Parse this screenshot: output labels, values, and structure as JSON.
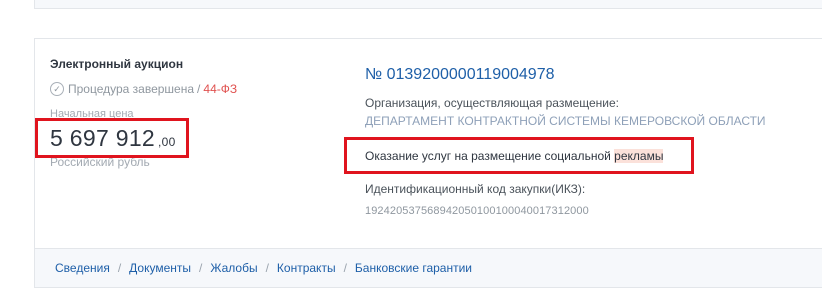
{
  "nav_tabs": [
    "Сведения",
    "Документы",
    "Жалобы",
    "Контракты",
    "Банковские гарантии"
  ],
  "auction": {
    "type": "Электронный аукцион",
    "status": "Процедура завершена",
    "law": "44-ФЗ",
    "price_label": "Начальная цена",
    "price_main": "5 697 912",
    "price_cents": ",00",
    "currency": "Российский рубль",
    "number": "№ 0139200000119004978",
    "org_label": "Организация, осуществляющая размещение:",
    "org_name": "ДЕПАРТАМЕНТ КОНТРАКТНОЙ СИСТЕМЫ КЕМЕРОВСКОЙ ОБЛАСТИ",
    "subject_plain": "Оказание услуг на размещение социальной ",
    "subject_highlight": "рекламы",
    "ikz_label": "Идентификационный код закупки(ИКЗ):",
    "ikz_value": "192420537568942050100100040017312000"
  },
  "colors": {
    "link": "#1e5fa8",
    "law": "#e0514f",
    "highlight_box": "#e0141e",
    "highlight_bg": "#fbe1da"
  },
  "icons": {
    "status": "check-circle-icon"
  }
}
